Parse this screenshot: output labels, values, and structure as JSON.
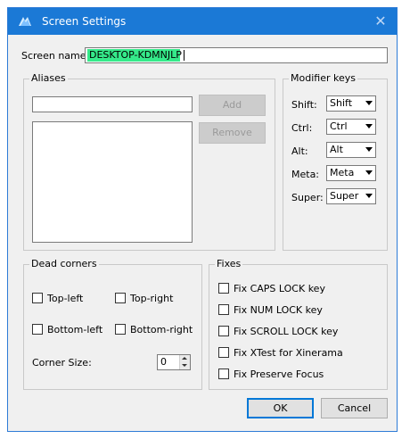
{
  "window": {
    "title": "Screen Settings"
  },
  "screen_name": {
    "label": "Screen name:",
    "value": "DESKTOP-KDMNJLP"
  },
  "aliases": {
    "legend": "Aliases",
    "input_value": "",
    "add_label": "Add",
    "remove_label": "Remove",
    "items": []
  },
  "modifier_keys": {
    "legend": "Modifier keys",
    "rows": [
      {
        "label": "Shift:",
        "value": "Shift"
      },
      {
        "label": "Ctrl:",
        "value": "Ctrl"
      },
      {
        "label": "Alt:",
        "value": "Alt"
      },
      {
        "label": "Meta:",
        "value": "Meta"
      },
      {
        "label": "Super:",
        "value": "Super"
      }
    ]
  },
  "dead_corners": {
    "legend": "Dead corners",
    "top_left": {
      "label": "Top-left",
      "checked": false
    },
    "top_right": {
      "label": "Top-right",
      "checked": false
    },
    "bottom_left": {
      "label": "Bottom-left",
      "checked": false
    },
    "bottom_right": {
      "label": "Bottom-right",
      "checked": false
    },
    "corner_size_label": "Corner Size:",
    "corner_size_value": "0"
  },
  "fixes": {
    "legend": "Fixes",
    "items": [
      {
        "label": "Fix CAPS LOCK key",
        "checked": false
      },
      {
        "label": "Fix NUM LOCK key",
        "checked": false
      },
      {
        "label": "Fix SCROLL LOCK key",
        "checked": false
      },
      {
        "label": "Fix XTest for Xinerama",
        "checked": false
      },
      {
        "label": "Fix Preserve Focus",
        "checked": false
      }
    ]
  },
  "buttons": {
    "ok_label": "OK",
    "cancel_label": "Cancel"
  },
  "colors": {
    "titlebar": "#1b79d6",
    "selection": "#16e07c",
    "window_bg": "#f0f0f0",
    "accent_border": "#0078d7"
  },
  "icons": {
    "app": "synergy-app-icon",
    "close": "close-icon"
  }
}
